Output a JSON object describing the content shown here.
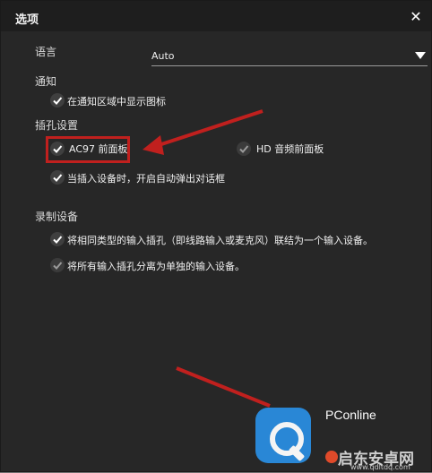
{
  "dialog": {
    "title": "选项",
    "close_glyph": "✕"
  },
  "language": {
    "label": "语言",
    "selected": "Auto"
  },
  "notification": {
    "section": "通知",
    "option": {
      "label": "在通知区域中显示图标",
      "checked": true
    }
  },
  "jack": {
    "section": "插孔设置",
    "options": [
      {
        "label": "AC97 前面板",
        "checked": true
      },
      {
        "label": "HD 音频前面板",
        "checked": false
      },
      {
        "label": "当插入设备时，开启自动弹出对话框",
        "checked": true
      }
    ]
  },
  "recording": {
    "section": "录制设备",
    "options": [
      {
        "label": "将相同类型的输入插孔（即线路输入或麦克风）联结为一个输入设备。",
        "checked": true
      },
      {
        "label": "将所有输入插孔分离为单独的输入设备。",
        "checked": false
      }
    ]
  },
  "watermark": {
    "brand": "PConline",
    "site_name": "启东安卓网",
    "url": "www.qdltdq.com"
  },
  "colors": {
    "annotation": "#c0201e",
    "dialog_bg": "#272727",
    "accent": "#4a86c8"
  }
}
